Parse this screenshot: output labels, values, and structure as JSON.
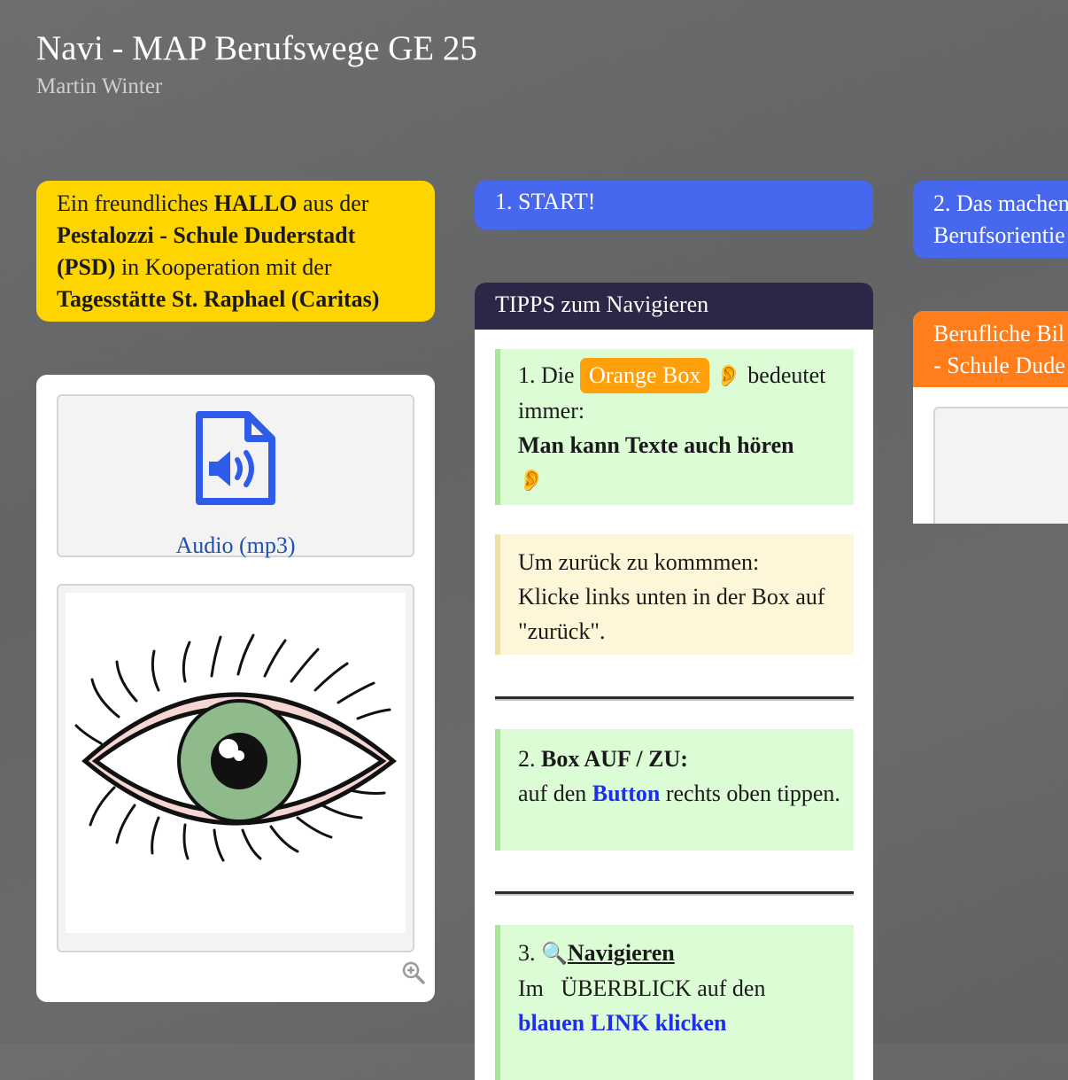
{
  "header": {
    "title": "Navi - MAP Berufswege GE 25",
    "author": "Martin Winter"
  },
  "welcome_card": {
    "t1": "Ein freundliches ",
    "t2": "HALLO",
    "t3": " aus der",
    "t4": "Pestalozzi - Schule Duderstadt",
    "t5": "(PSD)",
    "t6": " in Kooperation mit der",
    "t7": "Tagesstätte St. Raphael (Caritas)",
    "color": "#ffd500"
  },
  "media_card": {
    "audio_label": "Audio (mp3)",
    "audio_icon": "audio-file-icon",
    "image_icon": "eye-image",
    "zoom_icon": "zoom-in-icon"
  },
  "start_card": {
    "label": "1. START!",
    "color": "#4867ef"
  },
  "col3_card": {
    "line1": "2. Das machen",
    "line2": "Berufsorientie"
  },
  "tips_card": {
    "title": "TIPPS zum Navigieren",
    "tip1": {
      "prefix": "1. Die ",
      "pill": "Orange Box",
      "ear": "👂",
      "suffix": " bedeutet immer:",
      "bold": "Man kann Texte auch hören",
      "ear2": "👂"
    },
    "tip_back": {
      "line1": "Um zurück zu kommmen:",
      "line2": "Klicke links unten in der Box auf \"zurück\"."
    },
    "tip2": {
      "prefix": "2. ",
      "bold": "Box AUF / ZU:",
      "line2a": "auf den ",
      "button": "Button",
      "line2b": " rechts oben tippen."
    },
    "tip3": {
      "prefix": "3. ",
      "icon": "🔍",
      "title": "Navigieren",
      "line2": "Im   ÜBERBLICK auf den",
      "link": "blauen LINK klicken"
    }
  },
  "orange_card": {
    "line1": "Berufliche Bil",
    "line2": "- Schule Dude",
    "color": "#ff7d1a"
  }
}
